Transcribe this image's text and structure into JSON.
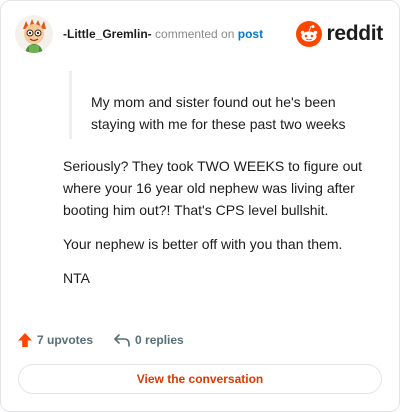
{
  "header": {
    "username": "-Little_Gremlin-",
    "action_text": "commented on",
    "post_link": "post",
    "brand_name": "reddit",
    "avatar_icon": "cartoon-gremlin-avatar-icon",
    "brand_icon": "reddit-snoo-icon"
  },
  "comment": {
    "quote": "My mom and sister found out he's been staying with me for these past two weeks",
    "paragraphs": [
      "Seriously? They took TWO WEEKS to figure out where your 16 year old nephew was living after booting him out?! That's CPS level bullshit.",
      "Your nephew is better off with you than them.",
      "NTA"
    ]
  },
  "footer": {
    "upvotes_label": "7 upvotes",
    "replies_label": "0 replies",
    "upvote_icon": "upvote-arrow-icon",
    "reply_icon": "reply-arrow-icon"
  },
  "cta": {
    "label": "View the conversation"
  },
  "colors": {
    "brand": "#ff4500",
    "link": "#0079d3",
    "cta_text": "#d93a00",
    "muted": "#576f76"
  }
}
